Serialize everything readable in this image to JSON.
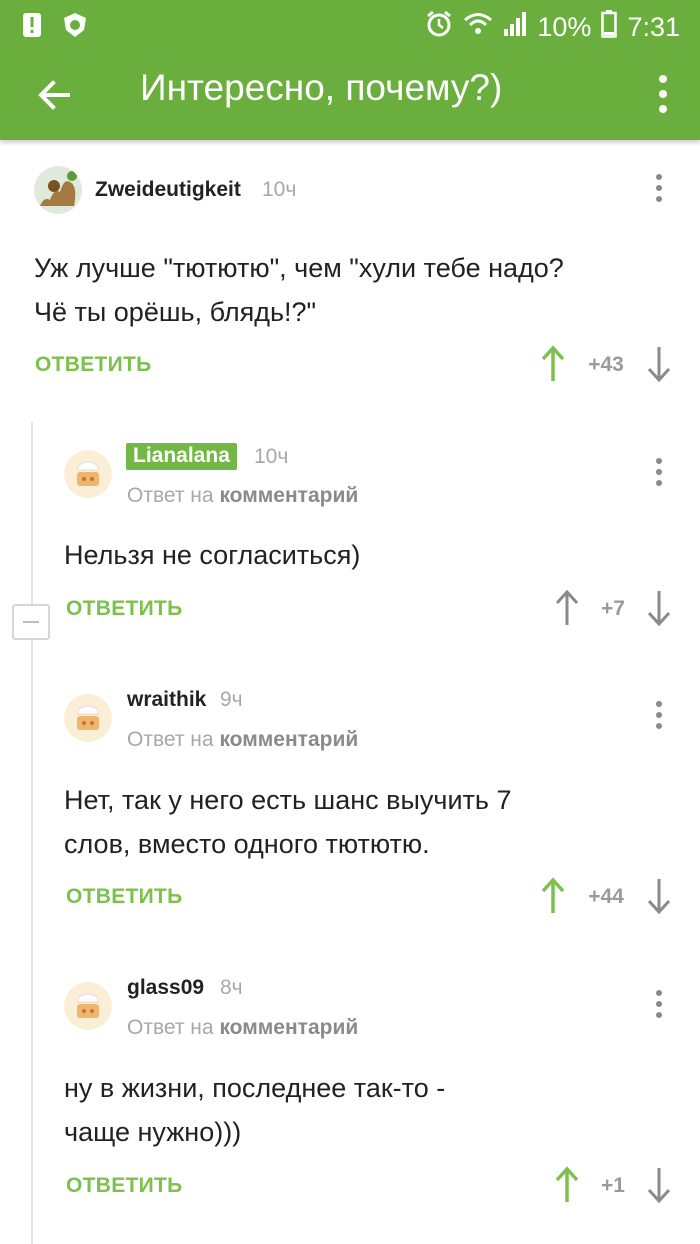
{
  "status_bar": {
    "battery": "10%",
    "time": "7:31"
  },
  "app_bar": {
    "title": "Интересно, почему?)"
  },
  "colors": {
    "brand_green": "#6aaf3d",
    "accent_green": "#7cc04e",
    "muted": "#a8a8a8"
  },
  "comments": [
    {
      "author": "Zweideutigkeit",
      "time": "10ч",
      "text_lines": [
        "Уж лучше \"тютютю\", чем \"хули тебе надо?",
        "Чё ты орёшь, блядь!?\""
      ],
      "reply_label": "ОТВЕТИТЬ",
      "score": "+43",
      "upvoted": true
    },
    {
      "author": "Lianalana",
      "time": "10ч",
      "reply_prefix": "Ответ на",
      "reply_target": "комментарий",
      "text_lines": [
        "Нельзя не согласиться)"
      ],
      "reply_label": "ОТВЕТИТЬ",
      "score": "+7",
      "upvoted": false
    },
    {
      "author": "wraithik",
      "time": "9ч",
      "reply_prefix": "Ответ на",
      "reply_target": "комментарий",
      "text_lines": [
        "Нет, так у него есть шанс выучить 7",
        "слов, вместо одного тютютю."
      ],
      "reply_label": "ОТВЕТИТЬ",
      "score": "+44",
      "upvoted": true
    },
    {
      "author": "glass09",
      "time": "8ч",
      "reply_prefix": "Ответ на",
      "reply_target": "комментарий",
      "text_lines": [
        "ну в жизни, последнее так-то -",
        "чаще нужно)))"
      ],
      "reply_label": "ОТВЕТИТЬ",
      "score": "+1",
      "upvoted": true
    }
  ]
}
